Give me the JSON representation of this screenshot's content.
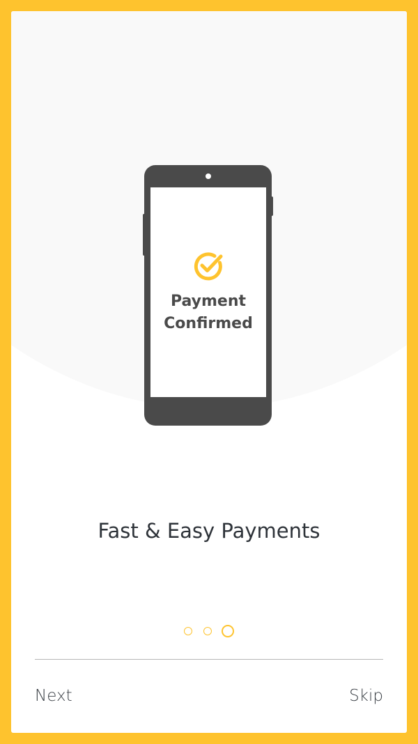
{
  "onboarding": {
    "phone_screen": {
      "icon": "check-circle-icon",
      "text_line1": "Payment",
      "text_line2": "Confirmed"
    },
    "headline": "Fast & Easy Payments",
    "pager": {
      "total": 3,
      "active_index": 2
    },
    "footer": {
      "next_label": "Next",
      "skip_label": "Skip"
    }
  },
  "colors": {
    "accent": "#FEC32E",
    "phone_body": "#4a4a4a",
    "text_dark": "#2e3339"
  }
}
